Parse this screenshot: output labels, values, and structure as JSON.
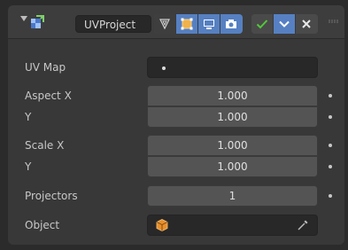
{
  "modifier": {
    "name": "UVProject",
    "icons": {
      "collapse": "disclosure-triangle-icon",
      "type": "uvproject-modifier-icon",
      "toggles": [
        "edit-cage-icon",
        "editmode-icon",
        "realtime-icon",
        "render-icon"
      ],
      "pin_group": [
        "apply-checkmark-icon",
        "dropdown-chevron-icon",
        "remove-x-icon"
      ],
      "drag": "drag-handle-icon"
    },
    "colors": {
      "accent": "#5680c2",
      "check": "#52c93a"
    }
  },
  "fields": {
    "uv_map": {
      "label": "UV Map",
      "value": ""
    },
    "aspect_x": {
      "label": "Aspect X",
      "value": "1.000"
    },
    "aspect_y": {
      "label": "Y",
      "value": "1.000"
    },
    "scale_x": {
      "label": "Scale X",
      "value": "1.000"
    },
    "scale_y": {
      "label": "Y",
      "value": "1.000"
    },
    "projectors": {
      "label": "Projectors",
      "value": "1"
    },
    "object": {
      "label": "Object",
      "value": "",
      "icon": "object-icon",
      "picker_icon": "eyedropper-icon"
    }
  }
}
